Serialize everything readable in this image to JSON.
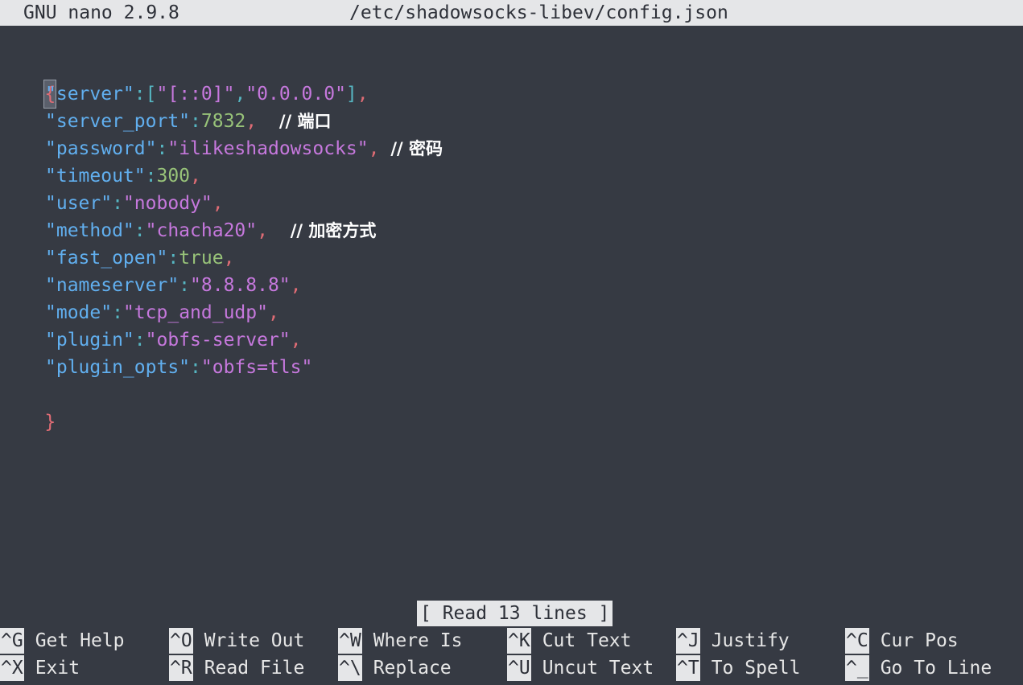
{
  "title": {
    "version": "GNU nano 2.9.8",
    "filename": "/etc/shadowsocks-libev/config.json"
  },
  "file": {
    "open_brace": "{",
    "close_brace": "}",
    "entries": [
      {
        "key": "\"server\"",
        "value_prefix": "[",
        "value_parts": [
          "\"[::0]\"",
          ",",
          "\"0.0.0.0\""
        ],
        "value_suffix": "]",
        "type": "array",
        "trail": ",",
        "comment": ""
      },
      {
        "key": "\"server_port\"",
        "value": "7832",
        "type": "number",
        "trail": ",",
        "comment": "// 端口"
      },
      {
        "key": "\"password\"",
        "value": "\"ilikeshadowsocks\"",
        "type": "string",
        "trail": ",",
        "comment": "// 密码"
      },
      {
        "key": "\"timeout\"",
        "value": "300",
        "type": "number",
        "trail": ",",
        "comment": ""
      },
      {
        "key": "\"user\"",
        "value": "\"nobody\"",
        "type": "string",
        "trail": ",",
        "comment": ""
      },
      {
        "key": "\"method\"",
        "value": "\"chacha20\"",
        "type": "string",
        "trail": ",",
        "comment": "// 加密方式"
      },
      {
        "key": "\"fast_open\"",
        "value": "true",
        "type": "bool",
        "trail": ",",
        "comment": ""
      },
      {
        "key": "\"nameserver\"",
        "value": "\"8.8.8.8\"",
        "type": "string",
        "trail": ",",
        "comment": ""
      },
      {
        "key": "\"mode\"",
        "value": "\"tcp_and_udp\"",
        "type": "string",
        "trail": ",",
        "comment": ""
      },
      {
        "key": "\"plugin\"",
        "value": "\"obfs-server\"",
        "type": "string",
        "trail": ",",
        "comment": ""
      },
      {
        "key": "\"plugin_opts\"",
        "value": "\"obfs=tls\"",
        "type": "string",
        "trail": "",
        "comment": ""
      }
    ]
  },
  "status": "[ Read 13 lines ]",
  "shortcuts": [
    {
      "key": "^G",
      "label": "Get Help",
      "name": "get-help"
    },
    {
      "key": "^O",
      "label": "Write Out",
      "name": "write-out"
    },
    {
      "key": "^W",
      "label": "Where Is",
      "name": "where-is"
    },
    {
      "key": "^K",
      "label": "Cut Text",
      "name": "cut-text"
    },
    {
      "key": "^J",
      "label": "Justify",
      "name": "justify"
    },
    {
      "key": "^C",
      "label": "Cur Pos",
      "name": "cur-pos"
    },
    {
      "key": "^X",
      "label": "Exit",
      "name": "exit"
    },
    {
      "key": "^R",
      "label": "Read File",
      "name": "read-file"
    },
    {
      "key": "^\\",
      "label": "Replace",
      "name": "replace"
    },
    {
      "key": "^U",
      "label": "Uncut Text",
      "name": "uncut-text"
    },
    {
      "key": "^T",
      "label": "To Spell",
      "name": "to-spell"
    },
    {
      "key": "^_",
      "label": "Go To Line",
      "name": "go-to-line"
    }
  ],
  "colors": {
    "background": "#363a43",
    "bar": "#e5e6e8",
    "key": "#61afef",
    "string": "#c678dd",
    "number": "#98c379",
    "punctuation": "#e06c75"
  }
}
